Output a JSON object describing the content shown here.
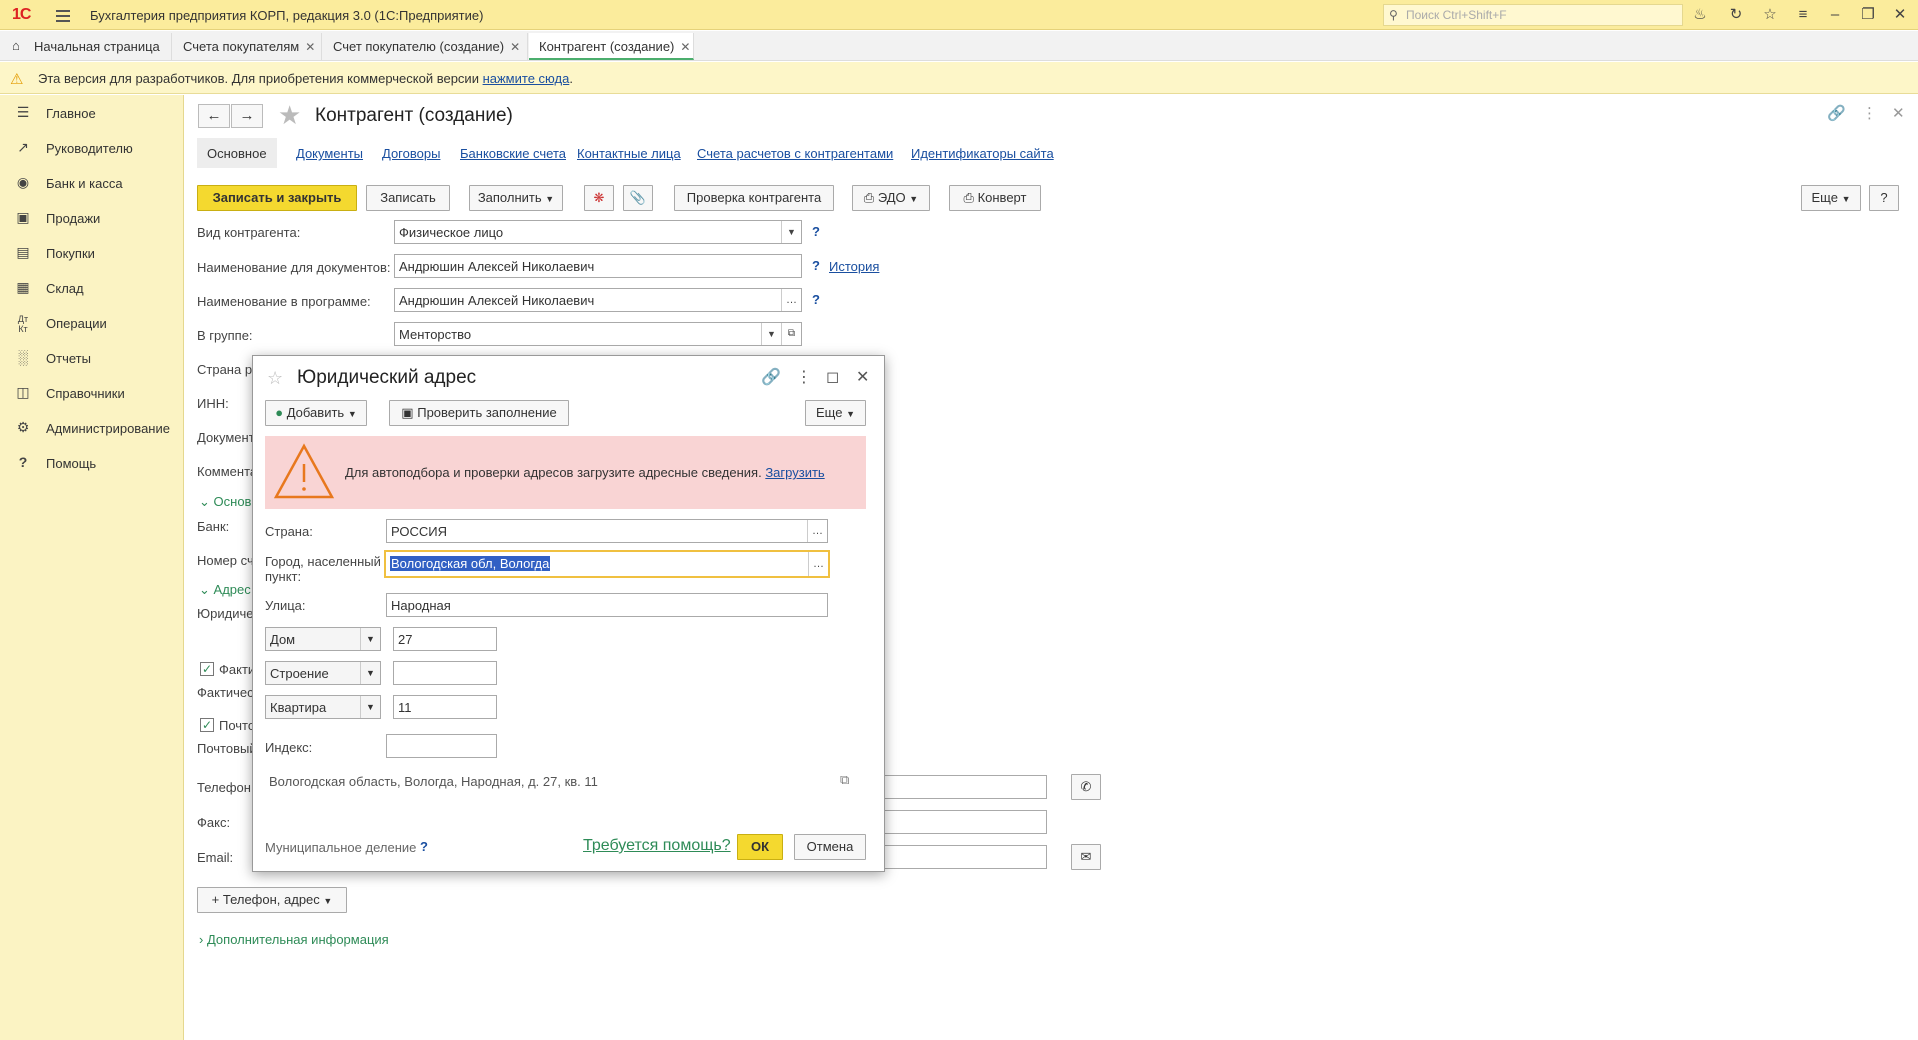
{
  "app": {
    "logo": "1С",
    "title": "Бухгалтерия предприятия КОРП, редакция 3.0  (1С:Предприятие)",
    "search_placeholder": "Поиск Ctrl+Shift+F"
  },
  "window_tabs": [
    {
      "label": "Начальная страница"
    },
    {
      "label": "Счета покупателям"
    },
    {
      "label": "Счет покупателю (создание)"
    },
    {
      "label": "Контрагент (создание)"
    }
  ],
  "dev_notice": {
    "text": "Эта версия для разработчиков. Для приобретения коммерческой версии ",
    "link": "нажмите сюда",
    "tail": "."
  },
  "sidebar": {
    "items": [
      {
        "label": "Главное",
        "icon": "menu-lines-icon"
      },
      {
        "label": "Руководителю",
        "icon": "trend-icon"
      },
      {
        "label": "Банк и касса",
        "icon": "coin-icon"
      },
      {
        "label": "Продажи",
        "icon": "bag-icon"
      },
      {
        "label": "Покупки",
        "icon": "cart-icon"
      },
      {
        "label": "Склад",
        "icon": "boxes-icon"
      },
      {
        "label": "Операции",
        "icon": "dt-kt-icon"
      },
      {
        "label": "Отчеты",
        "icon": "bar-chart-icon"
      },
      {
        "label": "Справочники",
        "icon": "books-icon"
      },
      {
        "label": "Администрирование",
        "icon": "gear-icon"
      },
      {
        "label": "Помощь",
        "icon": "question-icon"
      }
    ]
  },
  "form": {
    "title": "Контрагент (создание)",
    "tabs": [
      "Основное",
      "Документы",
      "Договоры",
      "Банковские счета",
      "Контактные лица",
      "Счета расчетов с контрагентами",
      "Идентификаторы сайта"
    ],
    "toolbar": {
      "save_close": "Записать и закрыть",
      "save": "Записать",
      "fill": "Заполнить",
      "check": "Проверка контрагента",
      "edo": "ЭДО",
      "envelope": "Конверт",
      "more": "Еще",
      "help": "?"
    },
    "fields": {
      "kind_label": "Вид контрагента:",
      "kind_value": "Физическое лицо",
      "doc_name_label": "Наименование для документов:",
      "doc_name_value": "Андрюшин Алексей Николаевич",
      "history_link": "История",
      "prog_name_label": "Наименование в программе:",
      "prog_name_value": "Андрюшин Алексей Николаевич",
      "group_label": "В группе:",
      "group_value": "Менторство",
      "country_label": "Страна ре",
      "inn_label": "ИНН:",
      "document_label": "Документ",
      "comment_label": "Коммента",
      "main_section": "Основ",
      "bank_label": "Банк:",
      "acc_number_label": "Номер сч",
      "address_section": "Адрес",
      "legal_label": "Юридиче",
      "fact_chk": "Факти",
      "fact_label": "Фактичес",
      "post_chk": "Почто",
      "post_label": "Почтовый",
      "phone_label": "Телефон:",
      "fax_label": "Факс:",
      "email_label": "Email:",
      "add_phone": "+ Телефон, адрес",
      "extra_info": "Дополнительная информация"
    }
  },
  "modal": {
    "title": "Юридический адрес",
    "add_btn": "Добавить",
    "check_btn": "Проверить заполнение",
    "more_btn": "Еще",
    "alert_text": "Для автоподбора и проверки адресов загрузите адресные сведения. ",
    "alert_link": "Загрузить",
    "country_label": "Страна:",
    "country_value": "РОССИЯ",
    "city_label": "Город, населенный пункт:",
    "city_value": "Вологодская обл, Вологда",
    "street_label": "Улица:",
    "street_value": "Народная",
    "house_type": "Дом",
    "house_value": "27",
    "building_type": "Строение",
    "building_value": "",
    "flat_type": "Квартира",
    "flat_value": "11",
    "index_label": "Индекс:",
    "index_value": "",
    "preview": "Вологодская область, Вологда, Народная, д. 27, кв. 11",
    "municipal": "Муниципальное деление",
    "help_link": "Требуется помощь?",
    "ok": "ОК",
    "cancel": "Отмена"
  }
}
